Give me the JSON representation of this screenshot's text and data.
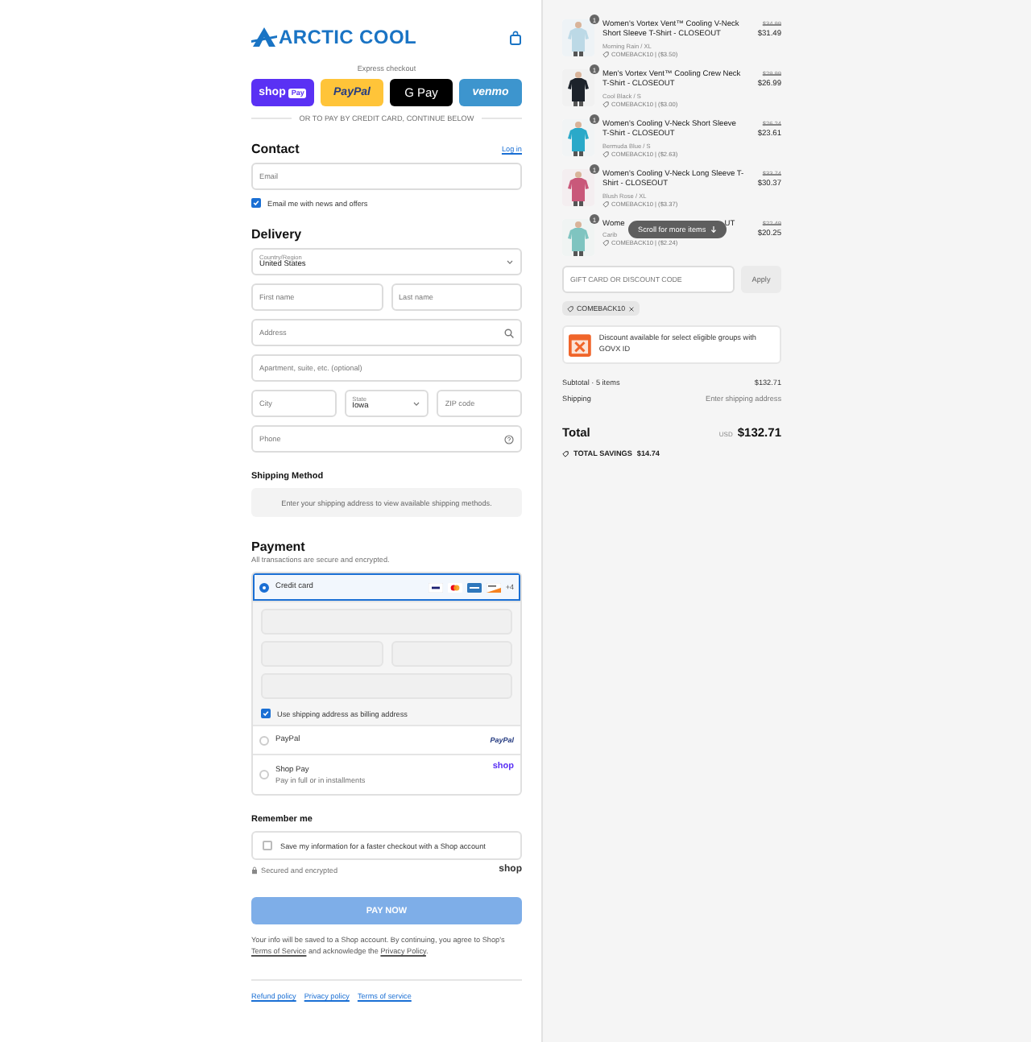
{
  "header": {
    "logo": "ARCTIC COOL"
  },
  "express": {
    "label": "Express checkout",
    "divider": "OR TO PAY BY CREDIT CARD, CONTINUE BELOW",
    "buttons": [
      {
        "kind": "shop",
        "label": "shop",
        "badge": "Pay"
      },
      {
        "kind": "paypal",
        "label": "PayPal"
      },
      {
        "kind": "gpay",
        "label": "G Pay"
      },
      {
        "kind": "venmo",
        "label": "venmo"
      }
    ]
  },
  "contact": {
    "title": "Contact",
    "login": "Log in",
    "email": {
      "placeholder": "Email"
    },
    "newsletter": {
      "label": "Email me with news and offers",
      "checked": true
    }
  },
  "delivery": {
    "title": "Delivery",
    "rows": [
      [
        {
          "kind": "select",
          "label": "Country/Region",
          "value": "United States"
        }
      ],
      [
        {
          "kind": "text",
          "placeholder": "First name"
        },
        {
          "kind": "text",
          "placeholder": "Last name"
        }
      ],
      [
        {
          "kind": "search",
          "placeholder": "Address"
        }
      ],
      [
        {
          "kind": "text",
          "placeholder": "Apartment, suite, etc. (optional)"
        }
      ],
      [
        {
          "kind": "text",
          "placeholder": "City"
        },
        {
          "kind": "select",
          "label": "State",
          "value": "Iowa"
        },
        {
          "kind": "text",
          "placeholder": "ZIP code"
        }
      ],
      [
        {
          "kind": "help",
          "placeholder": "Phone"
        }
      ]
    ]
  },
  "shipping": {
    "title": "Shipping Method",
    "message": "Enter your shipping address to view available shipping methods."
  },
  "payment": {
    "title": "Payment",
    "subtitle": "All transactions are secure and encrypted.",
    "methods": [
      {
        "kind": "card",
        "label": "Credit card",
        "selected": true,
        "more_cards": "+4",
        "billing": {
          "label": "Use shipping address as billing address",
          "checked": true
        }
      },
      {
        "kind": "paypal",
        "label": "PayPal",
        "logo": "PayPal",
        "selected": false
      },
      {
        "kind": "shop",
        "label": "Shop Pay",
        "note": "Pay in full or in installments",
        "logo": "shop",
        "selected": false
      }
    ]
  },
  "remember": {
    "title": "Remember me",
    "save": {
      "label": "Save my information for a faster checkout with a Shop account",
      "checked": false
    },
    "secure": "Secured and encrypted",
    "logo": "shop"
  },
  "pay_button": {
    "label": "PAY NOW",
    "disabled": true
  },
  "legal": [
    {
      "kind": "text",
      "text": "Your info will be saved to a Shop account. By continuing, you agree to Shop's "
    },
    {
      "kind": "link",
      "text": "Terms of Service"
    },
    {
      "kind": "text",
      "text": " and acknowledge the "
    },
    {
      "kind": "link",
      "text": "Privacy Policy"
    },
    {
      "kind": "text",
      "text": "."
    }
  ],
  "footer_links": [
    "Refund policy",
    "Privacy policy",
    "Terms of service"
  ],
  "summary": {
    "items": [
      {
        "quantity": "1",
        "title": "Women's Vortex Vent™ Cooling V-Neck Short Sleeve T-Shirt - CLOSEOUT",
        "variant": "Morning Rain / XL",
        "discount": "COMEBACK10 | ($3.50)",
        "compare_price": "$34.99",
        "price": "$31.49"
      },
      {
        "quantity": "1",
        "title": "Men's Vortex Vent™ Cooling Crew Neck T-Shirt - CLOSEOUT",
        "variant": "Cool Black / S",
        "discount": "COMEBACK10 | ($3.00)",
        "compare_price": "$29.99",
        "price": "$26.99"
      },
      {
        "quantity": "1",
        "title": "Women's Cooling V-Neck Short Sleeve T-Shirt - CLOSEOUT",
        "variant": "Bermuda Blue / S",
        "discount": "COMEBACK10 | ($2.63)",
        "compare_price": "$26.24",
        "price": "$23.61"
      },
      {
        "quantity": "1",
        "title": "Women's Cooling V-Neck Long Sleeve T-Shirt - CLOSEOUT",
        "variant": "Blush Rose / XL",
        "discount": "COMEBACK10 | ($3.37)",
        "compare_price": "$33.74",
        "price": "$30.37"
      },
      {
        "quantity": "1",
        "title_start": "Wome",
        "title_end": "UT",
        "variant": "Carib",
        "discount": "COMEBACK10 | ($2.24)",
        "compare_price": "$22.49",
        "price": "$20.25"
      }
    ],
    "scroll_hint": "Scroll for more items",
    "discount_field": {
      "placeholder": "GIFT CARD OR DISCOUNT CODE"
    },
    "apply": "Apply",
    "applied_code": "COMEBACK10",
    "govx": "Discount available for select eligible groups with GOVX ID",
    "subtotal_label": "Subtotal · 5 items",
    "subtotal": "$132.71",
    "shipping_label": "Shipping",
    "shipping": "Enter shipping address",
    "total_label": "Total",
    "currency": "USD",
    "total": "$132.71",
    "savings_label": "TOTAL SAVINGS",
    "savings": "$14.74"
  }
}
